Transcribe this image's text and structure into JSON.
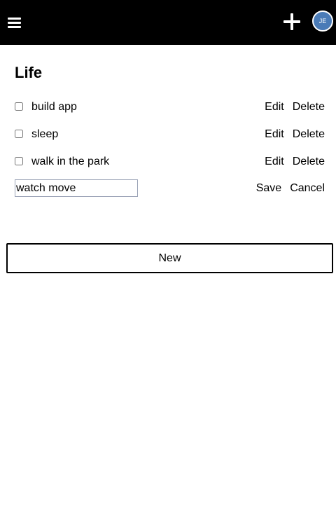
{
  "header": {
    "menu_icon": "hamburger-menu-icon",
    "add_icon": "plus-icon",
    "avatar_initials": "JE",
    "avatar_color": "#4a7bb7",
    "background_color": "#000000"
  },
  "list": {
    "title": "Life",
    "items": [
      {
        "label": "build app",
        "checked": false,
        "edit_label": "Edit",
        "delete_label": "Delete"
      },
      {
        "label": "sleep",
        "checked": false,
        "edit_label": "Edit",
        "delete_label": "Delete"
      },
      {
        "label": "walk in the park",
        "checked": false,
        "edit_label": "Edit",
        "delete_label": "Delete"
      }
    ],
    "editing": {
      "value": "watch move",
      "save_label": "Save",
      "cancel_label": "Cancel"
    },
    "new_button_label": "New"
  }
}
